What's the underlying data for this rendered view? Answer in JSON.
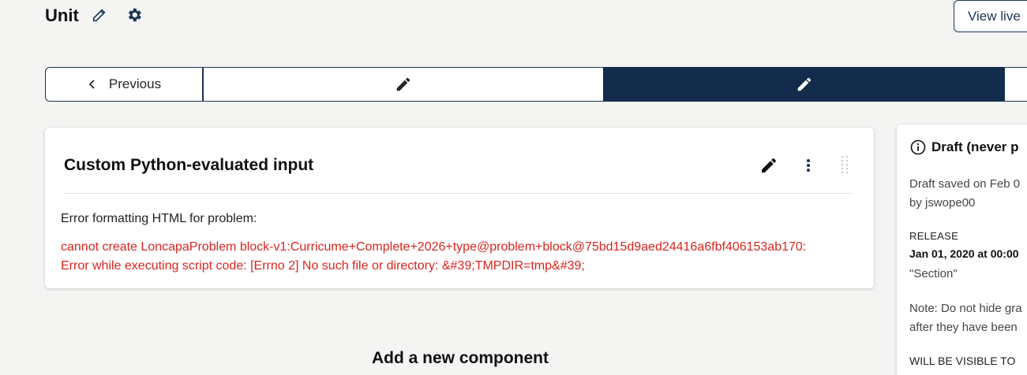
{
  "header": {
    "title": "Unit",
    "view_live_label": "View live"
  },
  "sequence_nav": {
    "previous_label": "Previous"
  },
  "component": {
    "title": "Custom Python-evaluated input",
    "error_label": "Error formatting HTML for problem:",
    "error_line1": "cannot create LoncapaProblem block-v1:Curricume+Complete+2026+type@problem+block@75bd15d9aed24416a6fbf406153ab170:",
    "error_line2": "Error while executing script code: [Errno 2] No such file or directory: &#39;TMPDIR=tmp&#39;"
  },
  "add_component": {
    "heading": "Add a new component"
  },
  "sidebar": {
    "status": "Draft (never p",
    "saved_line1": "Draft saved on Feb 0",
    "saved_line2": "by jswope00",
    "release_label": "RELEASE",
    "release_date": "Jan 01, 2020 at 00:00",
    "release_section": "\"Section\"",
    "note_line1": "Note: Do not hide gra",
    "note_line2": "after they have been",
    "visible_label": "WILL BE VISIBLE TO"
  },
  "colors": {
    "primary": "#132c4c",
    "error": "#d9251d",
    "background": "#f4f4f3"
  },
  "icons": {
    "edit": "pencil-icon",
    "settings": "gear-icon",
    "prev": "chevron-left-icon",
    "more": "kebab-icon",
    "drag": "drag-handle-icon",
    "info": "info-circle-icon"
  }
}
